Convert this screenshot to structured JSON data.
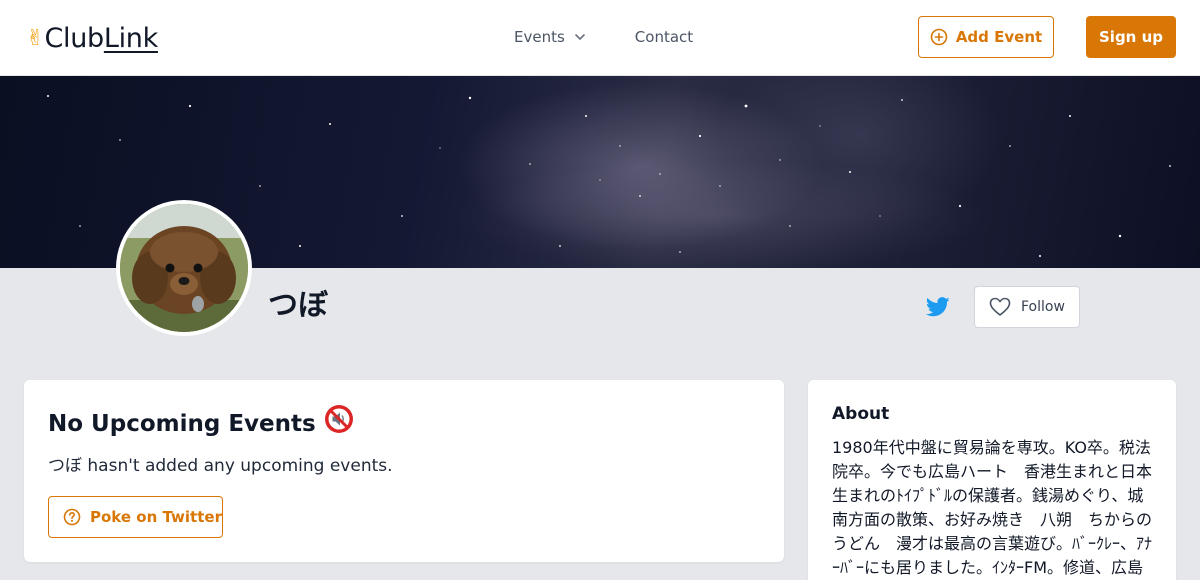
{
  "header": {
    "logo_emoji": "✌",
    "logo_text_start": "Club",
    "logo_text_end": "Link",
    "nav": [
      {
        "label": "Events",
        "has_dropdown": true
      },
      {
        "label": "Contact",
        "has_dropdown": false
      }
    ],
    "add_event_label": "Add Event",
    "sign_up_label": "Sign up"
  },
  "profile": {
    "name": "つぼ",
    "follow_label": "Follow",
    "twitter_icon": "twitter-icon"
  },
  "events": {
    "title": "No Upcoming Events",
    "title_icon": "muted-speaker-icon",
    "description": "つぼ hasn't added any upcoming events.",
    "poke_label": "Poke on Twitter"
  },
  "about": {
    "title": "About",
    "text": "1980年代中盤に貿易論を専攻。KO卒。税法院卒。今でも広島ハート　香港生まれと日本生まれのﾄｲﾌﾟﾄﾞﾙの保護者。銭湯めぐり、城南方面の散策、お好み焼き　八朔　ちからのうどん　漫才は最高の言葉遊び。ﾊﾞｰｸﾚｰ、ｱﾅｰﾊﾞｰにも居りました。ｲﾝﾀｰFM。修道、広島"
  },
  "colors": {
    "accent": "#d97706",
    "page_bg": "#e5e7eb",
    "twitter": "#1d9bf0"
  }
}
